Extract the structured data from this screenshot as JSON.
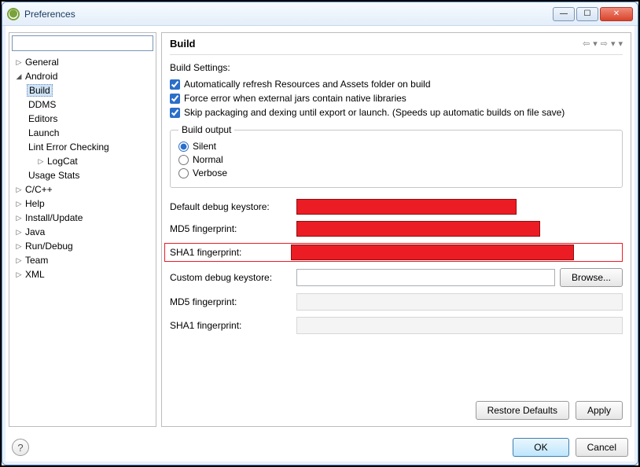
{
  "window": {
    "title": "Preferences"
  },
  "sidebar": {
    "filter_value": "",
    "items": [
      {
        "label": "General",
        "depth": 0,
        "exp": "▷",
        "selected": false
      },
      {
        "label": "Android",
        "depth": 0,
        "exp": "◢",
        "selected": false
      },
      {
        "label": "Build",
        "depth": 1,
        "exp": "",
        "selected": true
      },
      {
        "label": "DDMS",
        "depth": 1,
        "exp": "",
        "selected": false
      },
      {
        "label": "Editors",
        "depth": 1,
        "exp": "",
        "selected": false
      },
      {
        "label": "Launch",
        "depth": 1,
        "exp": "",
        "selected": false
      },
      {
        "label": "Lint Error Checking",
        "depth": 1,
        "exp": "",
        "selected": false
      },
      {
        "label": "LogCat",
        "depth": 1,
        "exp": "▷",
        "selected": false
      },
      {
        "label": "Usage Stats",
        "depth": 1,
        "exp": "",
        "selected": false
      },
      {
        "label": "C/C++",
        "depth": 0,
        "exp": "▷",
        "selected": false
      },
      {
        "label": "Help",
        "depth": 0,
        "exp": "▷",
        "selected": false
      },
      {
        "label": "Install/Update",
        "depth": 0,
        "exp": "▷",
        "selected": false
      },
      {
        "label": "Java",
        "depth": 0,
        "exp": "▷",
        "selected": false
      },
      {
        "label": "Run/Debug",
        "depth": 0,
        "exp": "▷",
        "selected": false
      },
      {
        "label": "Team",
        "depth": 0,
        "exp": "▷",
        "selected": false
      },
      {
        "label": "XML",
        "depth": 0,
        "exp": "▷",
        "selected": false
      }
    ]
  },
  "main": {
    "title": "Build",
    "section_label": "Build Settings:",
    "checkboxes": {
      "auto_refresh": {
        "label": "Automatically refresh Resources and Assets folder on build",
        "checked": true
      },
      "force_error": {
        "label": "Force error when external jars contain native libraries",
        "checked": true
      },
      "skip_packaging": {
        "label": "Skip packaging and dexing until export or launch. (Speeds up automatic builds on file save)",
        "checked": true
      }
    },
    "build_output": {
      "legend": "Build output",
      "silent": "Silent",
      "normal": "Normal",
      "verbose": "Verbose",
      "value": "silent"
    },
    "fields": {
      "default_keystore": "Default debug keystore:",
      "md5": "MD5 fingerprint:",
      "sha1": "SHA1 fingerprint:",
      "custom_keystore": "Custom debug keystore:",
      "md5_2": "MD5 fingerprint:",
      "sha1_2": "SHA1 fingerprint:",
      "custom_keystore_value": ""
    },
    "buttons": {
      "browse": "Browse...",
      "restore_defaults": "Restore Defaults",
      "apply": "Apply"
    }
  },
  "bottom": {
    "ok": "OK",
    "cancel": "Cancel"
  }
}
